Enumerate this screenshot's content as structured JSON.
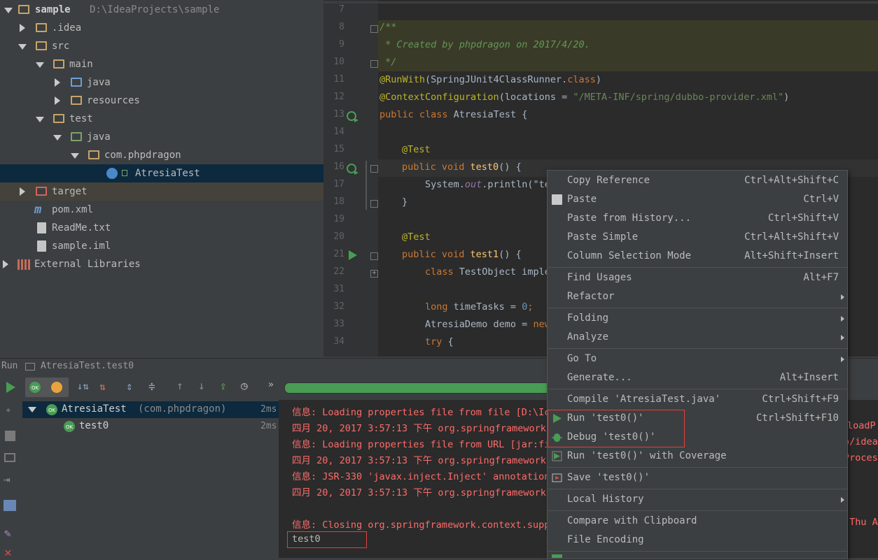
{
  "project_tree": {
    "root": {
      "name": "sample",
      "path": "D:\\IdeaProjects\\sample"
    },
    "items": [
      {
        "label": ".idea"
      },
      {
        "label": "src"
      },
      {
        "label": "main"
      },
      {
        "label": "java"
      },
      {
        "label": "resources"
      },
      {
        "label": "test"
      },
      {
        "label": "java"
      },
      {
        "label": "com.phpdragon"
      },
      {
        "label": "AtresiaTest"
      },
      {
        "label": "target"
      },
      {
        "label": "pom.xml"
      },
      {
        "label": "ReadMe.txt"
      },
      {
        "label": "sample.iml"
      },
      {
        "label": "External Libraries"
      }
    ]
  },
  "editor": {
    "line_numbers": [
      "7",
      "8",
      "9",
      "10",
      "11",
      "12",
      "13",
      "14",
      "15",
      "16",
      "17",
      "18",
      "19",
      "20",
      "21",
      "22",
      "31",
      "32",
      "33",
      "34"
    ],
    "code": {
      "l8": "/**",
      "l9": " * Created by phpdragon on 2017/4/20.",
      "l10": " */",
      "l11a": "@RunWith",
      "l11b": "(SpringJUnit4ClassRunner.",
      "l11c": "class",
      "l11d": ")",
      "l12a": "@ContextConfiguration",
      "l12b": "(locations = ",
      "l12c": "\"/META-INF/spring/dubbo-provider.xml\"",
      "l12d": ")",
      "l13a": "public class ",
      "l13b": "AtresiaTest {",
      "l15": "@Test",
      "l16a": "public void ",
      "l16b": "test0",
      "l16c": "() {",
      "l17a": "System.",
      "l17b": "out",
      "l17c": ".println(\"te",
      "l18": "}",
      "l20": "@Test",
      "l21a": "public void ",
      "l21b": "test1",
      "l21c": "() {",
      "l22a": "class ",
      "l22b": "TestObject imple",
      "l32a": "long ",
      "l32b": "timeTasks = ",
      "l32c": "0",
      "l32d": ";",
      "l33a": "AtresiaDemo demo = ",
      "l33b": "new",
      "l34a": "try",
      "l34b": " {"
    }
  },
  "run_panel": {
    "title": "Run",
    "tab": "AtresiaTest.test0",
    "test_tree": [
      {
        "label": "AtresiaTest",
        "pkg": "(com.phpdragon)",
        "time": "2ms",
        "badge": "OK"
      },
      {
        "label": "test0",
        "time": "2ms",
        "badge": "OK"
      }
    ],
    "console": [
      {
        "left": "信息: Loading properties file from file [D:\\Ic",
        "right": ""
      },
      {
        "left": "四月 20, 2017 3:57:13 下午 org.springframework",
        "right": "loadP"
      },
      {
        "left": "信息: Loading properties file from URL [jar:fi",
        "right": "o/idea"
      },
      {
        "left": "四月 20, 2017 3:57:13 下午 org.springframework",
        "right": "Process"
      },
      {
        "left": "信息: JSR-330 'javax.inject.Inject' annotation",
        "right": ""
      },
      {
        "left": "四月 20, 2017 3:57:13 下午 org.springframework",
        "right": ""
      },
      {
        "left": "",
        "right": ""
      },
      {
        "left": "信息: Closing org.springframework.context.supp",
        "right": "[Thu A"
      }
    ],
    "output": "test0"
  },
  "context_menu": {
    "items": [
      {
        "label": "Copy Reference",
        "key": "Ctrl+Alt+Shift+C"
      },
      {
        "label": "Paste",
        "key": "Ctrl+V"
      },
      {
        "label": "Paste from History...",
        "key": "Ctrl+Shift+V"
      },
      {
        "label": "Paste Simple",
        "key": "Ctrl+Alt+Shift+V"
      },
      {
        "label": "Column Selection Mode",
        "key": "Alt+Shift+Insert"
      },
      {
        "label": "Find Usages",
        "key": "Alt+F7"
      },
      {
        "label": "Refactor",
        "key": ""
      },
      {
        "label": "Folding",
        "key": ""
      },
      {
        "label": "Analyze",
        "key": ""
      },
      {
        "label": "Go To",
        "key": ""
      },
      {
        "label": "Generate...",
        "key": "Alt+Insert"
      },
      {
        "label": "Compile 'AtresiaTest.java'",
        "key": "Ctrl+Shift+F9"
      },
      {
        "label": "Run 'test0()'",
        "key": "Ctrl+Shift+F10"
      },
      {
        "label": "Debug 'test0()'",
        "key": ""
      },
      {
        "label": "Run 'test0()' with Coverage",
        "key": ""
      },
      {
        "label": "Save 'test0()'",
        "key": ""
      },
      {
        "label": "Local History",
        "key": ""
      },
      {
        "label": "Compare with Clipboard",
        "key": ""
      },
      {
        "label": "File Encoding",
        "key": ""
      }
    ]
  },
  "colors": {
    "highlight_box": "#e0403a",
    "progress": "#499c54"
  }
}
